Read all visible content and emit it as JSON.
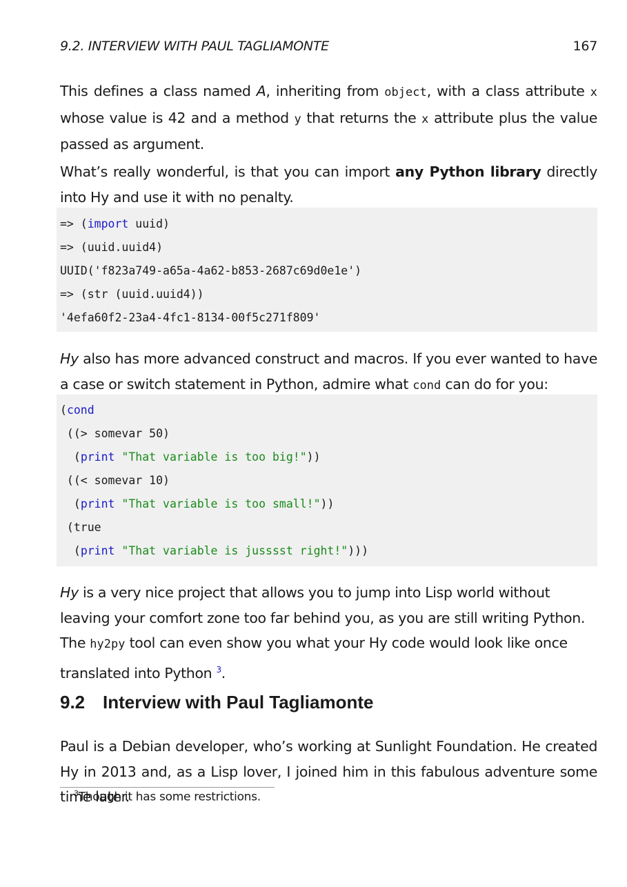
{
  "header": {
    "section_title": "9.2.  INTERVIEW WITH PAUL TAGLIAMONTE",
    "page_number": "167"
  },
  "p1": {
    "a": "This defines a class named ",
    "b": "A",
    "c": ", inheriting from ",
    "d": "object",
    "e": ", with a class attribute ",
    "f": "x",
    "g": " whose value is 42 and a method ",
    "h": "y",
    "i": " that returns the ",
    "j": "x",
    "k": " attribute plus the value passed as argument."
  },
  "p2": {
    "a": "What’s really wonderful, is that you can import ",
    "b": "any Python library",
    "c": " directly into Hy and use it with no penalty."
  },
  "code1": {
    "l1a": "=> (",
    "l1b": "import",
    "l1c": " uuid)",
    "l2": "=> (uuid.uuid4)",
    "l3": "UUID('f823a749-a65a-4a62-b853-2687c69d0e1e')",
    "l4": "=> (str (uuid.uuid4))",
    "l5": "'4efa60f2-23a4-4fc1-8134-00f5c271f809'"
  },
  "p3": {
    "a": "Hy",
    "b": " also has more advanced construct and macros.  If you ever wanted to have a case or switch statement in Python, admire what ",
    "c": "cond",
    "d": " can do for you:"
  },
  "code2": {
    "l1a": "(",
    "l1b": "cond",
    "l2": " ((> somevar 50)",
    "l3a": "  (",
    "l3b": "print",
    "l3c": " ",
    "l3d": "\"That variable is too big!\"",
    "l3e": "))",
    "l4": " ((< somevar 10)",
    "l5a": "  (",
    "l5b": "print",
    "l5c": " ",
    "l5d": "\"That variable is too small!\"",
    "l5e": "))",
    "l6": " (true",
    "l7a": "  (",
    "l7b": "print",
    "l7c": " ",
    "l7d": "\"That variable is jusssst right!\"",
    "l7e": ")))"
  },
  "p4": {
    "a": "Hy",
    "b": " is a very nice project that allows you to jump into Lisp world without leaving your comfort zone too far behind you, as you are still writing Python.  The ",
    "c": "hy2py",
    "d": " tool can even show you what your Hy code would look like once translated into Python ",
    "e": "3",
    "f": "."
  },
  "section": {
    "number": "9.2",
    "title": "Interview with Paul Tagliamonte"
  },
  "p5": "Paul is a Debian developer, who’s working at Sunlight Foundation.  He created Hy in 2013 and, as a Lisp lover, I joined him in this fabulous adventure some time later.",
  "footnote": {
    "mark": "3",
    "text": "Though it has some restrictions."
  }
}
